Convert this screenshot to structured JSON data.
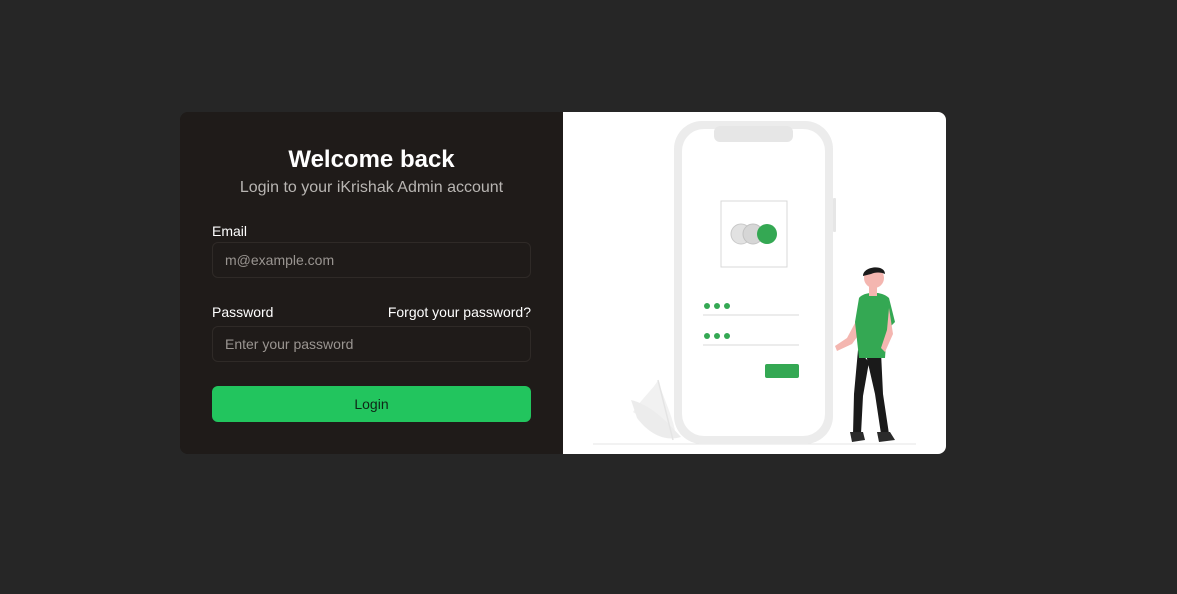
{
  "login": {
    "title": "Welcome back",
    "subtitle": "Login to your iKrishak Admin account",
    "email_label": "Email",
    "email_placeholder": "m@example.com",
    "email_value": "",
    "password_label": "Password",
    "forgot_password_label": "Forgot your password?",
    "password_placeholder": "Enter your password",
    "password_value": "",
    "login_button_label": "Login"
  },
  "illustration": {
    "name": "mobile-login-illustration",
    "accent_color": "#34a853"
  },
  "colors": {
    "page_background": "#262626",
    "panel_background": "#1f1b19",
    "accent": "#22c55e",
    "illustration_background": "#ffffff"
  }
}
